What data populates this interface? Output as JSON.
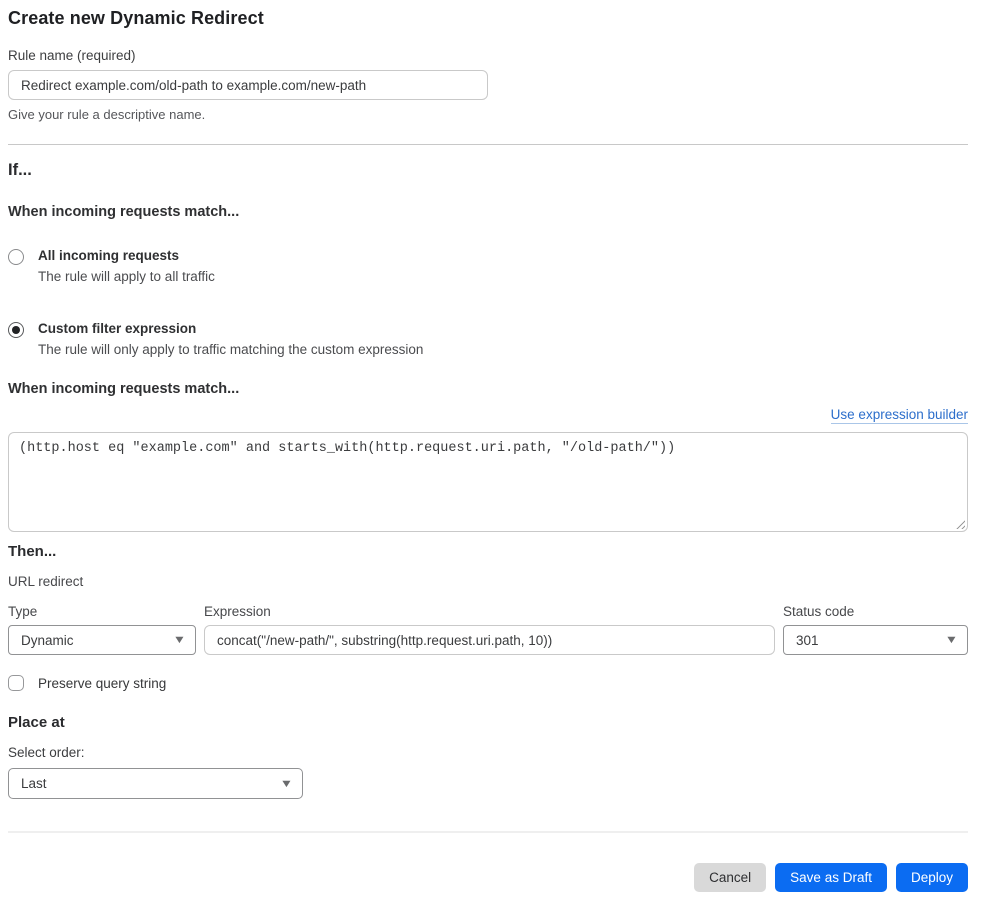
{
  "page": {
    "title": "Create new Dynamic Redirect"
  },
  "rule_name": {
    "label": "Rule name (required)",
    "value": "Redirect example.com/old-path to example.com/new-path",
    "help": "Give your rule a descriptive name."
  },
  "if_section": {
    "heading": "If...",
    "subheading": "When incoming requests match...",
    "options": [
      {
        "label": "All incoming requests",
        "description": "The rule will apply to all traffic",
        "selected": false
      },
      {
        "label": "Custom filter expression",
        "description": "The rule will only apply to traffic matching the custom expression",
        "selected": true
      }
    ]
  },
  "expression_section": {
    "heading": "When incoming requests match...",
    "builder_link_label": "Use expression builder",
    "value": "(http.host eq \"example.com\" and starts_with(http.request.uri.path, \"/old-path/\"))"
  },
  "then_section": {
    "heading": "Then...",
    "action_label": "URL redirect",
    "type": {
      "label": "Type",
      "value": "Dynamic"
    },
    "expression": {
      "label": "Expression",
      "value": "concat(\"/new-path/\", substring(http.request.uri.path, 10))"
    },
    "status_code": {
      "label": "Status code",
      "value": "301"
    },
    "preserve_query": {
      "label": "Preserve query string",
      "checked": false
    }
  },
  "place_at": {
    "heading": "Place at",
    "label": "Select order:",
    "value": "Last"
  },
  "footer": {
    "cancel_label": "Cancel",
    "save_draft_label": "Save as Draft",
    "deploy_label": "Deploy"
  },
  "icons": {
    "select_caret": "▼"
  },
  "colors": {
    "primary_blue": "#0b6cf2",
    "link_blue": "#2c6ecb",
    "cancel_gray": "#d9d9d9"
  }
}
